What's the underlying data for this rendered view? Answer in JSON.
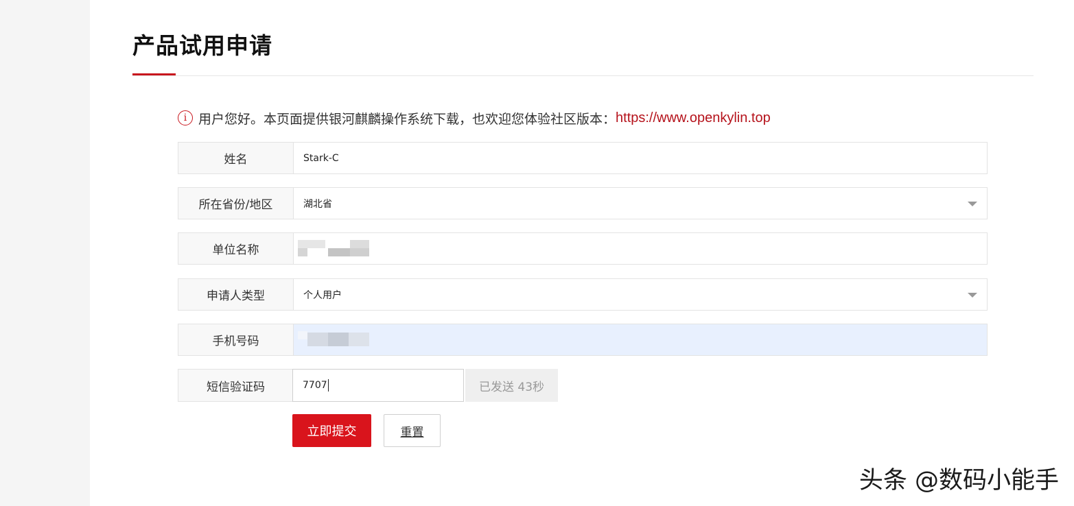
{
  "page": {
    "title": "产品试用申请"
  },
  "notice": {
    "icon": "info-icon",
    "text": "用户您好。本页面提供银河麒麟操作系统下载，也欢迎您体验社区版本：",
    "link_text": "https://www.openkylin.top",
    "link_color": "#b5121b"
  },
  "form": {
    "name": {
      "label": "姓名",
      "value": "Stark-C"
    },
    "province": {
      "label": "所在省份/地区",
      "value": "湖北省"
    },
    "company": {
      "label": "单位名称",
      "value": ""
    },
    "applicant_type": {
      "label": "申请人类型",
      "value": "个人用户"
    },
    "phone": {
      "label": "手机号码",
      "value": ""
    },
    "sms_code": {
      "label": "短信验证码",
      "value": "7707"
    },
    "sent_status": "已发送 43秒",
    "submit_label": "立即提交",
    "reset_label": "重置"
  },
  "watermark": "头条 @数码小能手",
  "colors": {
    "accent": "#c8161d",
    "submit_bg": "#d9141c",
    "autofill_bg": "#e8f0fe"
  }
}
